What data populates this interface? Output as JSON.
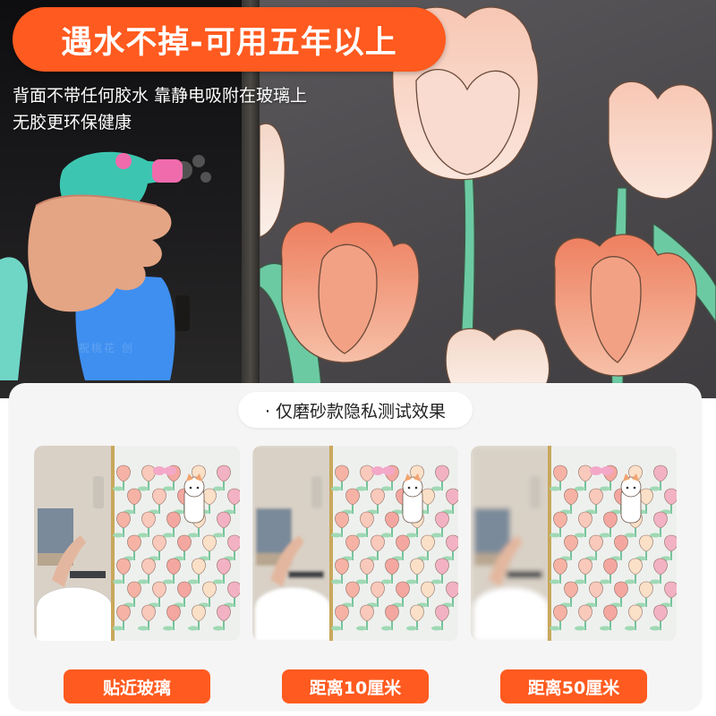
{
  "headline": "遇水不掉-可用五年以上",
  "subtitle_lines": [
    "背面不带任何胶水 靠静电吸附在玻璃上",
    "无胶更环保健康"
  ],
  "watermark": "祝桃花 创",
  "test_section": {
    "title": "· 仅磨砂款隐私测试效果",
    "panels": [
      {
        "caption": "贴近玻璃"
      },
      {
        "caption": "距离10厘米"
      },
      {
        "caption": "距离50厘米"
      }
    ]
  },
  "colors": {
    "accent_orange": "#ff5a1f",
    "tulip_peach": "#f6b9a3",
    "tulip_coral": "#f08a6c",
    "stem_green": "#5fc39a",
    "card_bg": "#f6f5f5"
  },
  "icons": [
    "spray-bottle-icon",
    "butterfly-icon",
    "cat-icon"
  ]
}
